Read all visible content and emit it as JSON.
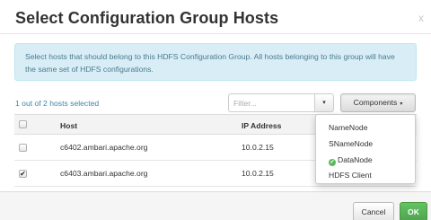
{
  "modal": {
    "title": "Select Configuration Group Hosts",
    "close_label": "x"
  },
  "info_alert": {
    "text": "Select hosts that should belong to this HDFS Configuration Group. All hosts belonging to this group will have the same set of HDFS configurations."
  },
  "toolbar": {
    "selected_count": "1 out of 2 hosts selected",
    "filter_placeholder": "Filter...",
    "filter_dropdown_caret": "▾",
    "components_label": "Components",
    "components_caret": "▾"
  },
  "table": {
    "columns": [
      "Host",
      "IP Address"
    ],
    "rows": [
      {
        "host": "c6402.ambari.apache.org",
        "ip": "10.0.2.15",
        "checked": false,
        "check_glyph": ""
      },
      {
        "host": "c6403.ambari.apache.org",
        "ip": "10.0.2.15",
        "checked": true,
        "check_glyph": "✔"
      }
    ]
  },
  "components_menu": {
    "items": [
      {
        "label": "NameNode",
        "selected": false
      },
      {
        "label": "SNameNode",
        "selected": false
      },
      {
        "label": "DataNode",
        "selected": true,
        "check_glyph": "✔"
      },
      {
        "label": "HDFS Client",
        "selected": false
      }
    ]
  },
  "footer": {
    "cancel_label": "Cancel",
    "ok_label": "OK"
  },
  "colors": {
    "info_background": "#d9edf7",
    "link_blue": "#3a87ad",
    "success_green": "#5cb85c"
  }
}
